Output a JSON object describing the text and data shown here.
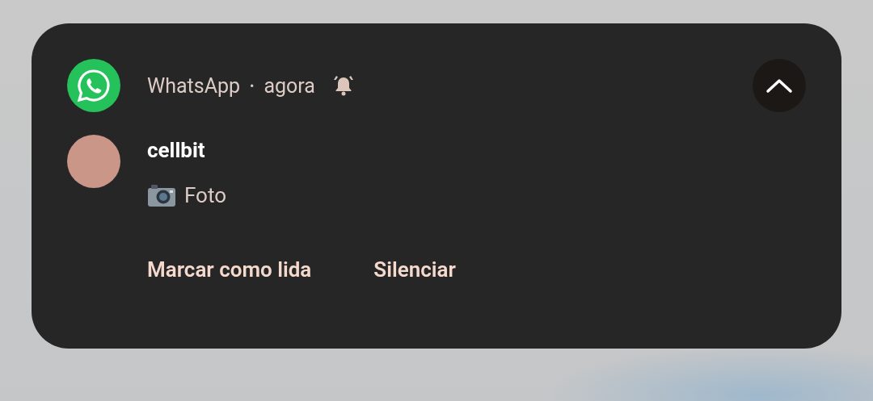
{
  "notification": {
    "app_name": "WhatsApp",
    "separator": "•",
    "time": "agora",
    "alerting": true,
    "expanded": true,
    "sender": "cellbit",
    "message": "Foto",
    "actions": [
      "Marcar como lida",
      "Silenciar"
    ]
  }
}
